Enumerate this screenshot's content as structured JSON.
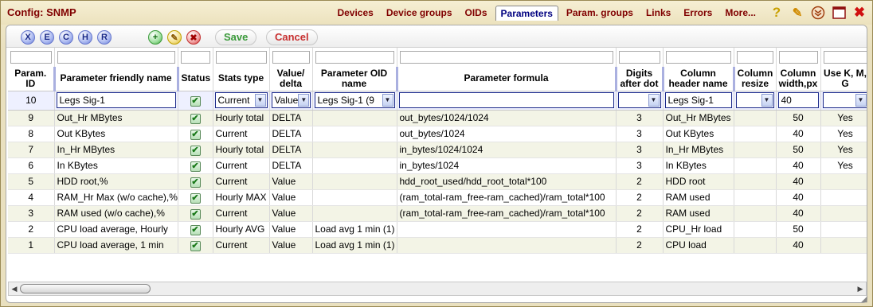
{
  "window": {
    "title": "Config: SNMP"
  },
  "nav": {
    "items": [
      "Devices",
      "Device groups",
      "OIDs",
      "Parameters",
      "Param. groups",
      "Links",
      "Errors",
      "More..."
    ],
    "active": "Parameters"
  },
  "toolbar": {
    "round_buttons": [
      "X",
      "E",
      "C",
      "H",
      "R"
    ],
    "add_glyph": "+",
    "edit_glyph": "✎",
    "delete_glyph": "✖",
    "save_label": "Save",
    "cancel_label": "Cancel",
    "icons": [
      "help-icon",
      "pencil-icon",
      "chevron-circle-icon",
      "maximize-icon",
      "close-icon"
    ]
  },
  "columns": [
    "Param. ID",
    "Parameter friendly name",
    "Status",
    "Stats type",
    "Value/ delta",
    "Parameter OID name",
    "Parameter formula",
    "Digits after dot",
    "Column header name",
    "Column resize",
    "Column width,px",
    "Use K, M, G"
  ],
  "edit_row": {
    "id": "10",
    "name": "Legs Sig-1",
    "stats_type": "Current",
    "value_delta": "Value",
    "oid_name": "Legs Sig-1 (9",
    "formula": "",
    "column_header": "Legs Sig-1",
    "column_width": "40"
  },
  "rows": [
    {
      "id": "9",
      "name": "Out_Hr MBytes",
      "stats": "Hourly total",
      "vd": "DELTA",
      "oid": "",
      "formula": "out_bytes/1024/1024",
      "digits": "3",
      "header": "Out_Hr MBytes",
      "resize": "",
      "width": "50",
      "kmg": "Yes"
    },
    {
      "id": "8",
      "name": "Out KBytes",
      "stats": "Current",
      "vd": "DELTA",
      "oid": "",
      "formula": "out_bytes/1024",
      "digits": "3",
      "header": "Out KBytes",
      "resize": "",
      "width": "40",
      "kmg": "Yes"
    },
    {
      "id": "7",
      "name": "In_Hr MBytes",
      "stats": "Hourly total",
      "vd": "DELTA",
      "oid": "",
      "formula": "in_bytes/1024/1024",
      "digits": "3",
      "header": "In_Hr MBytes",
      "resize": "",
      "width": "50",
      "kmg": "Yes"
    },
    {
      "id": "6",
      "name": "In KBytes",
      "stats": "Current",
      "vd": "DELTA",
      "oid": "",
      "formula": "in_bytes/1024",
      "digits": "3",
      "header": "In KBytes",
      "resize": "",
      "width": "40",
      "kmg": "Yes"
    },
    {
      "id": "5",
      "name": "HDD root,%",
      "stats": "Current",
      "vd": "Value",
      "oid": "",
      "formula": "hdd_root_used/hdd_root_total*100",
      "digits": "2",
      "header": "HDD root",
      "resize": "",
      "width": "40",
      "kmg": ""
    },
    {
      "id": "4",
      "name": "RAM_Hr Max (w/o cache),%",
      "stats": "Hourly MAX",
      "vd": "Value",
      "oid": "",
      "formula": "(ram_total-ram_free-ram_cached)/ram_total*100",
      "digits": "2",
      "header": "RAM used",
      "resize": "",
      "width": "40",
      "kmg": ""
    },
    {
      "id": "3",
      "name": "RAM used (w/o cache),%",
      "stats": "Current",
      "vd": "Value",
      "oid": "",
      "formula": "(ram_total-ram_free-ram_cached)/ram_total*100",
      "digits": "2",
      "header": "RAM used",
      "resize": "",
      "width": "40",
      "kmg": ""
    },
    {
      "id": "2",
      "name": "CPU load average, Hourly",
      "stats": "Hourly AVG",
      "vd": "Value",
      "oid": "Load avg 1 min (1)",
      "formula": "",
      "digits": "2",
      "header": "CPU_Hr load",
      "resize": "",
      "width": "50",
      "kmg": ""
    },
    {
      "id": "1",
      "name": "CPU load average, 1 min",
      "stats": "Current",
      "vd": "Value",
      "oid": "Load avg 1 min (1)",
      "formula": "",
      "digits": "2",
      "header": "CPU load",
      "resize": "",
      "width": "40",
      "kmg": ""
    }
  ],
  "checkmark": "✔",
  "colors": {
    "title": "#800000",
    "accent": "#1c2a8a"
  }
}
